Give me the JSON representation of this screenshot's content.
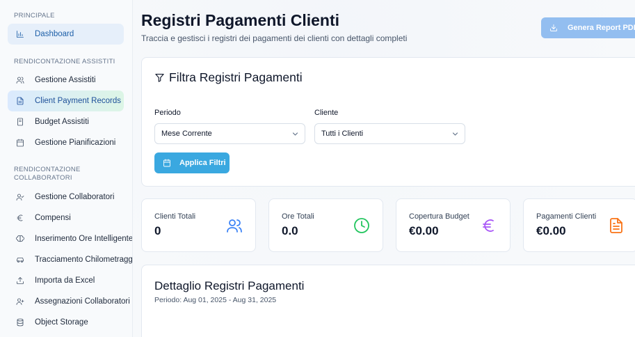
{
  "sidebar": {
    "sections": [
      {
        "title": "PRINCIPALE"
      },
      {
        "title": "RENDICONTAZIONE ASSISTITI"
      },
      {
        "title": "RENDICONTAZIONE COLLABORATORI"
      }
    ],
    "items": [
      {
        "label": "Dashboard",
        "icon": "bar-chart-icon"
      },
      {
        "label": "Gestione Assistiti",
        "icon": "users-icon"
      },
      {
        "label": "Client Payment Records",
        "icon": "file-text-icon"
      },
      {
        "label": "Budget Assistiti",
        "icon": "notebook-icon"
      },
      {
        "label": "Gestione Pianificazioni",
        "icon": "calendar-icon"
      },
      {
        "label": "Gestione Collaboratori",
        "icon": "user-check-icon"
      },
      {
        "label": "Compensi",
        "icon": "euro-icon"
      },
      {
        "label": "Inserimento Ore Intelligente",
        "icon": "brain-icon"
      },
      {
        "label": "Tracciamento Chilometraggio",
        "icon": "car-icon"
      },
      {
        "label": "Importa da Excel",
        "icon": "upload-icon"
      },
      {
        "label": "Assegnazioni Collaboratori",
        "icon": "user-plus-icon"
      },
      {
        "label": "Object Storage",
        "icon": "database-icon"
      }
    ]
  },
  "header": {
    "title": "Registri Pagamenti Clienti",
    "subtitle": "Traccia e gestisci i registri dei pagamenti dei clienti con dettagli completi",
    "pdf_button": "Genera Report PDF"
  },
  "filters": {
    "title": "Filtra Registri Pagamenti",
    "period_label": "Periodo",
    "period_value": "Mese Corrente",
    "client_label": "Cliente",
    "client_value": "Tutti i Clienti",
    "apply_button": "Applica Filtri"
  },
  "stats": [
    {
      "label": "Clienti Totali",
      "value": "0",
      "icon": "users-icon",
      "color": "#3b82f6"
    },
    {
      "label": "Ore Totali",
      "value": "0.0",
      "icon": "clock-icon",
      "color": "#22c55e"
    },
    {
      "label": "Copertura Budget",
      "value": "€0.00",
      "icon": "euro-icon",
      "color": "#a855f7"
    },
    {
      "label": "Pagamenti Clienti",
      "value": "€0.00",
      "icon": "file-text-icon",
      "color": "#f97316"
    }
  ],
  "detail": {
    "title": "Dettaglio Registri Pagamenti",
    "period": "Periodo: Aug 01, 2025 - Aug 31, 2025"
  }
}
